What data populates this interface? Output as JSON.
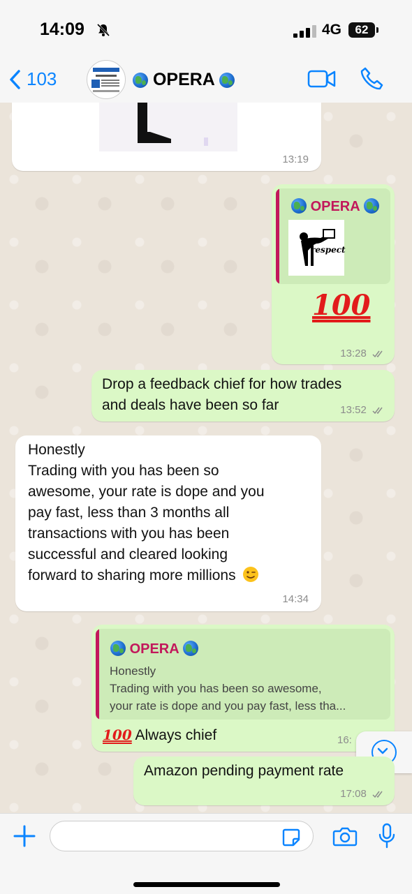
{
  "status_bar": {
    "time": "14:09",
    "network": "4G",
    "battery": "62"
  },
  "header": {
    "back_count": "103",
    "title": "OPERA"
  },
  "messages": {
    "m1": {
      "time": "13:19"
    },
    "m2": {
      "quote_author": "OPERA",
      "quote_image_text": "respect",
      "body": "100",
      "time": "13:28"
    },
    "m3": {
      "line1": "Drop a feedback chief for how trades",
      "line2": "and deals have been so far",
      "time": "13:52"
    },
    "m4": {
      "lines": [
        "Honestly",
        "Trading with you has been so",
        "awesome, your rate is dope and you",
        "pay fast, less than 3 months all",
        "transactions with you has been",
        "successful and cleared looking",
        "forward to sharing more millions"
      ],
      "time": "14:34"
    },
    "m5": {
      "quote_author": "OPERA",
      "quote_line1": "Honestly",
      "quote_line2": "Trading with you has been so awesome,",
      "quote_line3": "your rate is dope and you pay fast, less tha...",
      "emoji": "100",
      "body": "Always chief",
      "time": "16:"
    },
    "m6": {
      "body": "Amazon pending payment rate",
      "time": "17:08"
    }
  },
  "icons": [
    "bell-slash-icon",
    "signal-icon",
    "back-chevron-icon",
    "video-call-icon",
    "phone-call-icon",
    "globe-icon",
    "wink-emoji-icon",
    "chevron-down-icon",
    "plus-icon",
    "sticker-icon",
    "camera-icon",
    "microphone-icon",
    "double-check-icon"
  ],
  "colors": {
    "accent": "#0a84ff",
    "outgoing": "#dbf8c6",
    "incoming": "#ffffff",
    "quote_author": "#c2185b"
  }
}
